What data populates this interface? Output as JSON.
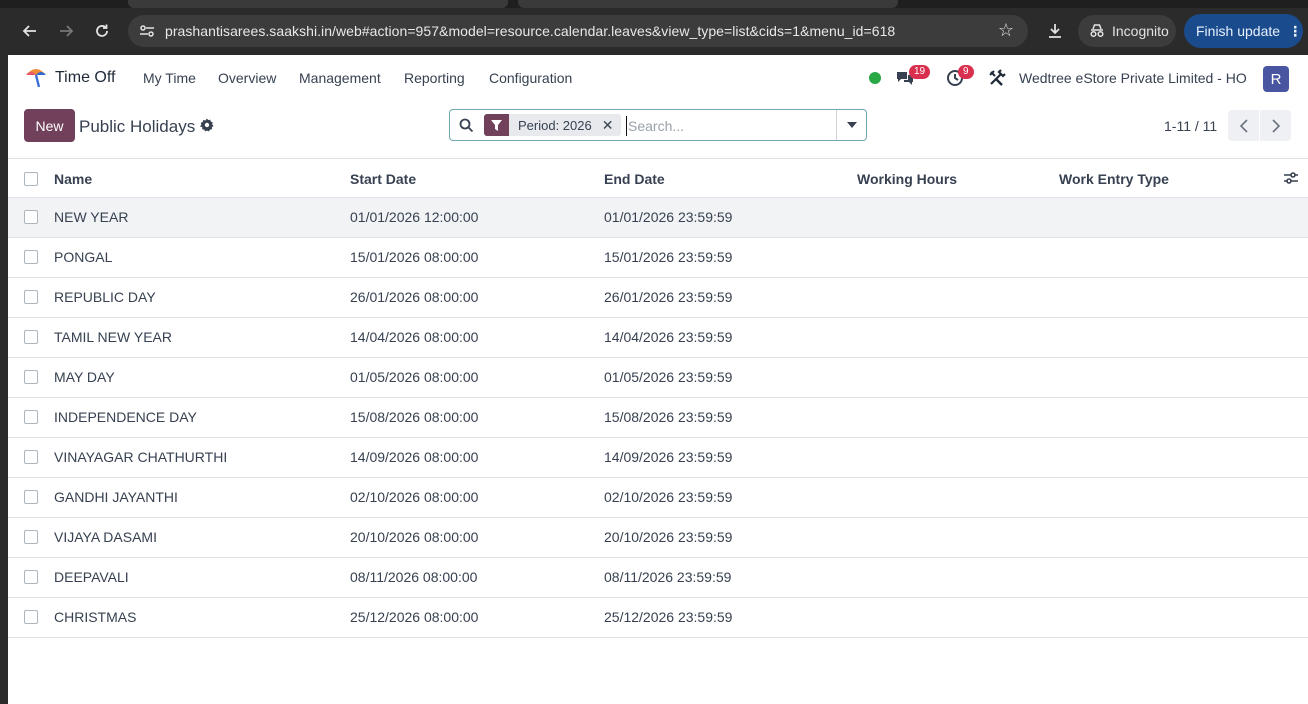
{
  "browser": {
    "url": "prashantisarees.saakshi.in/web#action=957&model=resource.calendar.leaves&view_type=list&cids=1&menu_id=618",
    "incognito_label": "Incognito",
    "update_label": "Finish update"
  },
  "navbar": {
    "app_name": "Time Off",
    "menus": [
      "My Time",
      "Overview",
      "Management",
      "Reporting",
      "Configuration"
    ],
    "messages_count": "19",
    "activities_count": "9",
    "company": "Wedtree eStore Private Limited - HO",
    "avatar_letter": "R"
  },
  "control_panel": {
    "new_label": "New",
    "title": "Public Holidays",
    "facet_label": "Period: 2026",
    "search_placeholder": "Search...",
    "pager": "1-11 / 11"
  },
  "table": {
    "columns": [
      "Name",
      "Start Date",
      "End Date",
      "Working Hours",
      "Work Entry Type"
    ],
    "rows": [
      {
        "name": "NEW YEAR",
        "start": "01/01/2026 12:00:00",
        "end": "01/01/2026 23:59:59"
      },
      {
        "name": "PONGAL",
        "start": "15/01/2026 08:00:00",
        "end": "15/01/2026 23:59:59"
      },
      {
        "name": "REPUBLIC DAY",
        "start": "26/01/2026 08:00:00",
        "end": "26/01/2026 23:59:59"
      },
      {
        "name": "TAMIL NEW YEAR",
        "start": "14/04/2026 08:00:00",
        "end": "14/04/2026 23:59:59"
      },
      {
        "name": "MAY DAY",
        "start": "01/05/2026 08:00:00",
        "end": "01/05/2026 23:59:59"
      },
      {
        "name": "INDEPENDENCE DAY",
        "start": "15/08/2026 08:00:00",
        "end": "15/08/2026 23:59:59"
      },
      {
        "name": "VINAYAGAR CHATHURTHI",
        "start": "14/09/2026 08:00:00",
        "end": "14/09/2026 23:59:59"
      },
      {
        "name": "GANDHI JAYANTHI",
        "start": "02/10/2026 08:00:00",
        "end": "02/10/2026 23:59:59"
      },
      {
        "name": "VIJAYA DASAMI",
        "start": "20/10/2026 08:00:00",
        "end": "20/10/2026 23:59:59"
      },
      {
        "name": "DEEPAVALI",
        "start": "08/11/2026 08:00:00",
        "end": "08/11/2026 23:59:59"
      },
      {
        "name": "CHRISTMAS",
        "start": "25/12/2026 08:00:00",
        "end": "25/12/2026 23:59:59"
      }
    ]
  },
  "colors": {
    "brand": "#71405b",
    "badge": "#d9304f",
    "online": "#28a745"
  },
  "icons": [
    "back-icon",
    "forward-icon",
    "reload-icon",
    "site-info-icon",
    "star-icon",
    "download-icon",
    "incognito-icon",
    "kebab-icon",
    "app-logo",
    "chat-icon",
    "activity-icon",
    "tools-icon",
    "gear-icon",
    "search-icon",
    "filter-icon",
    "close-icon",
    "caret-down-icon",
    "chevron-left-icon",
    "chevron-right-icon",
    "column-options-icon"
  ]
}
